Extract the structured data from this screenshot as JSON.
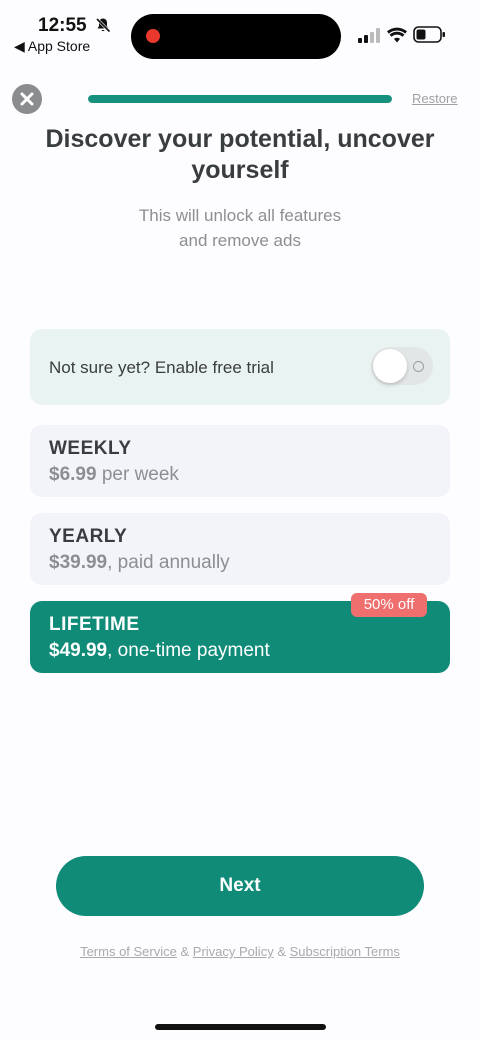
{
  "status_bar": {
    "time": "12:55",
    "back_label": "◀ App Store",
    "bell_icon": "bell-slash-icon",
    "signal_icon": "cellular-signal-icon",
    "wifi_icon": "wifi-icon",
    "battery_icon": "battery-icon"
  },
  "header": {
    "close_icon": "close-icon",
    "progress_fraction": 1.0,
    "restore_label": "Restore"
  },
  "title": "Discover your potential, uncover yourself",
  "subtitle_line1": "This will unlock all features",
  "subtitle_line2": "and remove ads",
  "trial": {
    "label": "Not sure yet? Enable free trial",
    "enabled": false
  },
  "plans": [
    {
      "name": "WEEKLY",
      "price": "$6.99",
      "period": " per week",
      "selected": false
    },
    {
      "name": "YEARLY",
      "price": "$39.99",
      "period": ", paid annually",
      "selected": false
    },
    {
      "name": "LIFETIME",
      "price": "$49.99",
      "period": ", one-time payment",
      "selected": true,
      "badge": "50% off"
    }
  ],
  "next_label": "Next",
  "legal": {
    "terms": "Terms of Service",
    "sep1": " & ",
    "privacy": "Privacy Policy",
    "sep2": " & ",
    "subscription": "Subscription Terms"
  },
  "colors": {
    "accent": "#0f8b78",
    "badge": "#ef6e6e",
    "card_bg": "#f2f4fa",
    "trial_bg": "#e9f3f1"
  }
}
